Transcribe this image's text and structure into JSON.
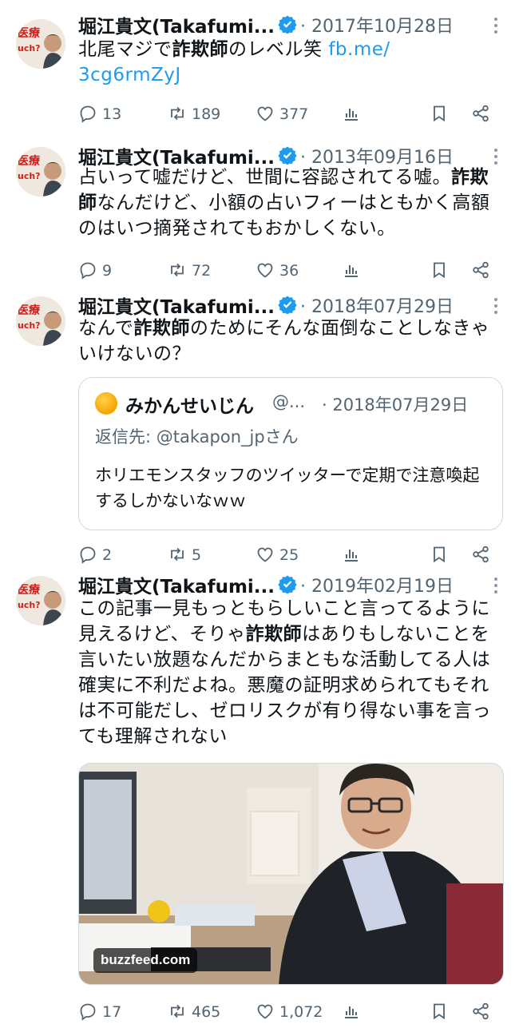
{
  "tweets": [
    {
      "author_name": "堀江貴文(Takafumi...",
      "date": "· 2017年10月28日",
      "text_parts": [
        {
          "text": "北尾マジで",
          "style": "normal"
        },
        {
          "text": "詐欺師",
          "style": "bold"
        },
        {
          "text": "のレベル笑 ",
          "style": "normal"
        },
        {
          "text": "fb.me/\n3cg6rmZyJ",
          "style": "link"
        }
      ],
      "replies": "13",
      "retweets": "189",
      "likes": "377"
    },
    {
      "author_name": "堀江貴文(Takafumi...",
      "date": "· 2013年09月16日",
      "text_parts": [
        {
          "text": "占いって嘘だけど、世間に容認されてる嘘。",
          "style": "normal"
        },
        {
          "text": "詐欺師",
          "style": "bold"
        },
        {
          "text": "なんだけど、小額の占いフィーはともかく高額のはいつ摘発されてもおかしくない。",
          "style": "normal"
        }
      ],
      "replies": "9",
      "retweets": "72",
      "likes": "36"
    },
    {
      "author_name": "堀江貴文(Takafumi...",
      "date": "· 2018年07月29日",
      "text_parts": [
        {
          "text": "なんで",
          "style": "normal"
        },
        {
          "text": "詐欺師",
          "style": "bold"
        },
        {
          "text": "のためにそんな面倒なことしなきゃいけないの？",
          "style": "normal"
        }
      ],
      "quote": {
        "name": "みかんせいじん",
        "handle": "@...",
        "date": "· 2018年07月29日",
        "reply_to": "返信先: @takapon_jpさん",
        "text": "ホリエモンスタッフのツイッターで定期で注意喚起するしかないなｗｗ"
      },
      "replies": "2",
      "retweets": "5",
      "likes": "25"
    },
    {
      "author_name": "堀江貴文(Takafumi...",
      "date": "· 2019年02月19日",
      "text_parts": [
        {
          "text": "この記事一見もっともらしいこと言ってるように見えるけど、そりゃ",
          "style": "normal"
        },
        {
          "text": "詐欺師",
          "style": "bold"
        },
        {
          "text": "はありもしないことを言いたい放題なんだからまともな活動してる人は確実に不利だよね。悪魔の証明求められてもそれは不可能だし、ゼロリスクが有り得ない事を言っても理解されない",
          "style": "normal"
        }
      ],
      "media_source": "buzzfeed.com",
      "replies": "17",
      "retweets": "465",
      "likes": "1,072"
    }
  ],
  "icons": {
    "reply": "reply-icon",
    "retweet": "retweet-icon",
    "like": "heart-icon",
    "views": "views-icon",
    "bookmark": "bookmark-icon",
    "share": "share-icon",
    "verified": "verified-badge-icon",
    "more": "more-options-icon"
  },
  "colors": {
    "accent": "#1d9bf0",
    "secondary_text": "#536471",
    "primary_text": "#0f1419",
    "border": "#cfd9de"
  }
}
